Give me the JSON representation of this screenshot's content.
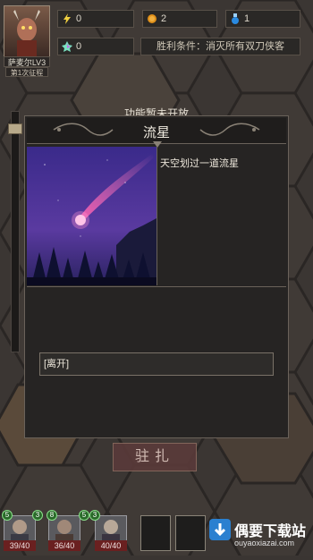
{
  "hero": {
    "name": "萨麦尔LV3",
    "stage": "第1次征程"
  },
  "stats": {
    "energy": "0",
    "gold": "2",
    "potion": "1",
    "crystal": "0"
  },
  "goal": "胜利条件：消灭所有双刀侠客",
  "dialog": {
    "notice": "功能暂未开放",
    "title": "流星",
    "description": "天空划过一道流星",
    "option": "[离开]"
  },
  "station_button": "驻扎",
  "party": [
    {
      "hp": "39/40",
      "level": "5",
      "level2": "3"
    },
    {
      "hp": "36/40",
      "level": "8",
      "level2": "5"
    },
    {
      "hp": "40/40",
      "level": "3",
      "level2": ""
    }
  ],
  "watermark": {
    "title": "偶要下载站",
    "url": "ouyaoxiazai.com"
  },
  "colors": {
    "accent": "#f0ebe0",
    "hp_bar": "#6a2020",
    "level_badge": "#2a6a2a"
  }
}
